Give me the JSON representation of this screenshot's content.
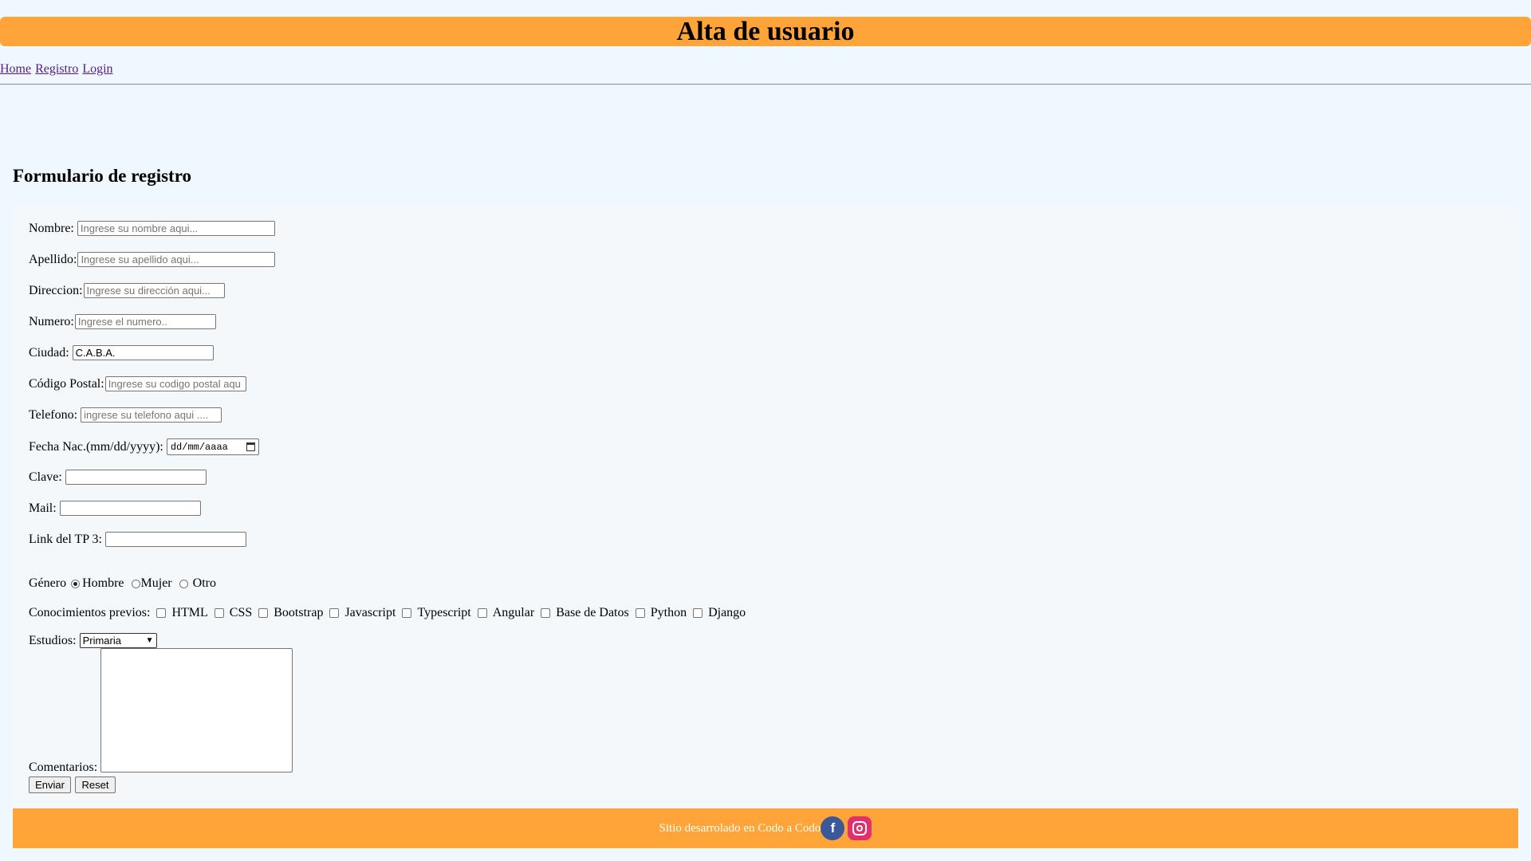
{
  "header": {
    "title": "Alta de usuario"
  },
  "nav": {
    "links": [
      "Home",
      "Registro",
      "Login"
    ]
  },
  "form": {
    "title": "Formulario de registro",
    "fields": {
      "nombre": {
        "label": "Nombre:",
        "placeholder": "Ingrese su nombre aqui...",
        "value": ""
      },
      "apellido": {
        "label": "Apellido:",
        "placeholder": "Ingrese su apellido aqui...",
        "value": ""
      },
      "direccion": {
        "label": "Direccion:",
        "placeholder": "Ingrese su dirección aqui...",
        "value": ""
      },
      "numero": {
        "label": "Numero:",
        "placeholder": "Ingrese el numero..",
        "value": ""
      },
      "ciudad": {
        "label": "Ciudad:",
        "placeholder": "",
        "value": "C.A.B.A."
      },
      "codigo_postal": {
        "label": "Código Postal:",
        "placeholder": "Ingrese su codigo postal aqu",
        "value": ""
      },
      "telefono": {
        "label": "Telefono:",
        "placeholder": "ingrese su telefono aqui ....",
        "value": ""
      },
      "fecha_nac": {
        "label": "Fecha Nac.(mm/dd/yyyy):",
        "display": "dd/mm/aaaa"
      },
      "clave": {
        "label": "Clave:",
        "value": ""
      },
      "mail": {
        "label": "Mail:",
        "value": ""
      },
      "link_tp3": {
        "label": "Link del TP 3:",
        "value": ""
      }
    },
    "genero": {
      "label": "Género",
      "options": [
        {
          "label": "Hombre",
          "selected": true
        },
        {
          "label": "Mujer",
          "selected": false
        },
        {
          "label": "Otro",
          "selected": false
        }
      ]
    },
    "conocimientos": {
      "label": "Conocimientos previos:",
      "options": [
        "HTML",
        "CSS",
        "Bootstrap",
        "Javascript",
        "Typescript",
        "Angular",
        "Base de Datos",
        "Python",
        "Django"
      ]
    },
    "estudios": {
      "label": "Estudios:",
      "selected": "Primaria"
    },
    "comentarios": {
      "label": "Comentarios:"
    },
    "buttons": {
      "submit": "Enviar",
      "reset": "Reset"
    }
  },
  "footer": {
    "text": "Sitio desarrolado en Codo a Codo"
  },
  "icons": {
    "facebook": "facebook-icon",
    "instagram": "instagram-icon"
  },
  "colors": {
    "accent": "#ffa438",
    "background": "#f0f8ff",
    "form_bg": "#f5f8fa",
    "link": "#551a8b"
  }
}
